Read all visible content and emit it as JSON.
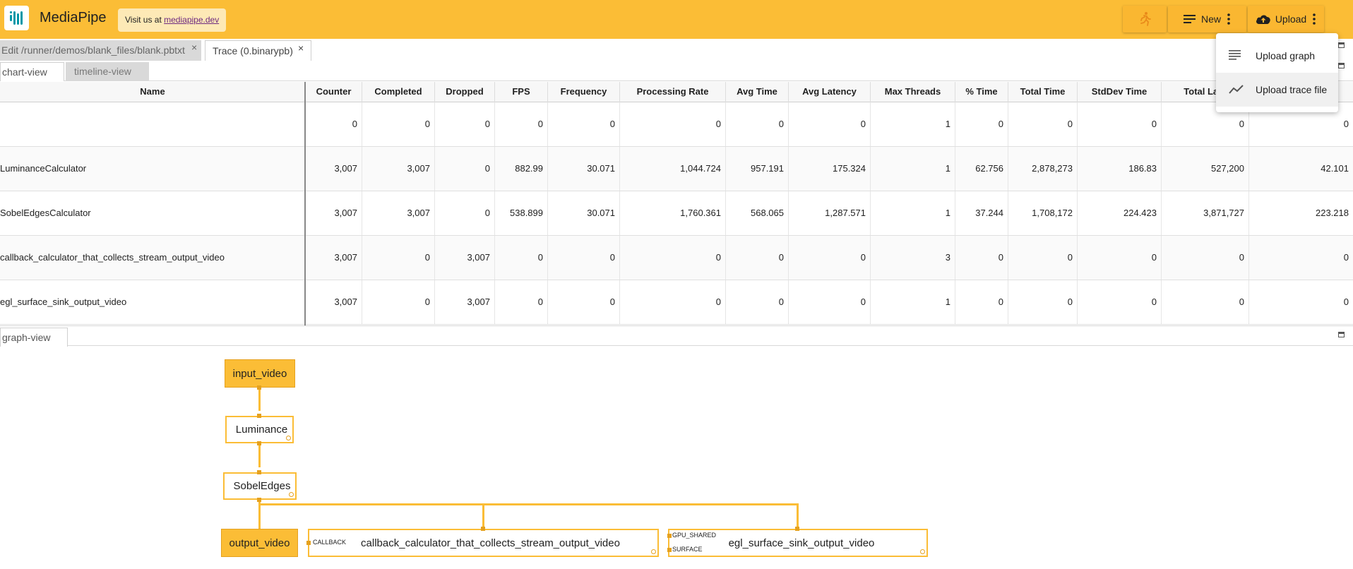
{
  "header": {
    "app_title": "MediaPipe",
    "visit_text": "Visit us at ",
    "visit_link": "mediapipe.dev",
    "new_label": "New",
    "upload_label": "Upload",
    "colors": {
      "bar": "#fbbd36",
      "accent_teal": "#0097a7",
      "link": "#6d2a80"
    }
  },
  "upload_menu": {
    "items": [
      {
        "label": "Upload graph",
        "icon": "lines-icon"
      },
      {
        "label": "Upload trace file",
        "icon": "trending-icon"
      }
    ]
  },
  "editor_tabs": [
    {
      "label": "Edit /runner/demos/blank_files/blank.pbtxt",
      "close": "×",
      "active": false
    },
    {
      "label": "Trace (0.binarypb)",
      "close": "×",
      "active": true
    }
  ],
  "top_panel_tabs": [
    {
      "label": "chart-view",
      "active": true
    },
    {
      "label": "timeline-view",
      "active": false
    }
  ],
  "bottom_panel_tabs": [
    {
      "label": "graph-view",
      "active": true
    }
  ],
  "table": {
    "columns": [
      "Name",
      "Counter",
      "Completed",
      "Dropped",
      "FPS",
      "Frequency",
      "Processing Rate",
      "Avg Time",
      "Avg Latency",
      "Max Threads",
      "% Time",
      "Total Time",
      "StdDev Time",
      "Total Late",
      ""
    ],
    "rows": [
      [
        "",
        "0",
        "0",
        "0",
        "0",
        "0",
        "0",
        "0",
        "0",
        "1",
        "0",
        "0",
        "0",
        "0",
        "0"
      ],
      [
        "LuminanceCalculator",
        "3,007",
        "3,007",
        "0",
        "882.99",
        "30.071",
        "1,044.724",
        "957.191",
        "175.324",
        "1",
        "62.756",
        "2,878,273",
        "186.83",
        "527,200",
        "42.101"
      ],
      [
        "SobelEdgesCalculator",
        "3,007",
        "3,007",
        "0",
        "538.899",
        "30.071",
        "1,760.361",
        "568.065",
        "1,287.571",
        "1",
        "37.244",
        "1,708,172",
        "224.423",
        "3,871,727",
        "223.218"
      ],
      [
        "callback_calculator_that_collects_stream_output_video",
        "3,007",
        "0",
        "3,007",
        "0",
        "0",
        "0",
        "0",
        "0",
        "3",
        "0",
        "0",
        "0",
        "0",
        "0"
      ],
      [
        "egl_surface_sink_output_video",
        "3,007",
        "0",
        "3,007",
        "0",
        "0",
        "0",
        "0",
        "0",
        "1",
        "0",
        "0",
        "0",
        "0",
        "0"
      ]
    ]
  },
  "graph": {
    "nodes": {
      "input_video": "input_video",
      "luminance": "Luminance",
      "sobel": "SobelEdges",
      "output_video": "output_video",
      "callback": "callback_calculator_that_collects_stream_output_video",
      "egl": "egl_surface_sink_output_video"
    },
    "ports": {
      "callback_in": "CALLBACK",
      "gpu_shared": "GPU_SHARED",
      "surface": "SURFACE"
    }
  }
}
